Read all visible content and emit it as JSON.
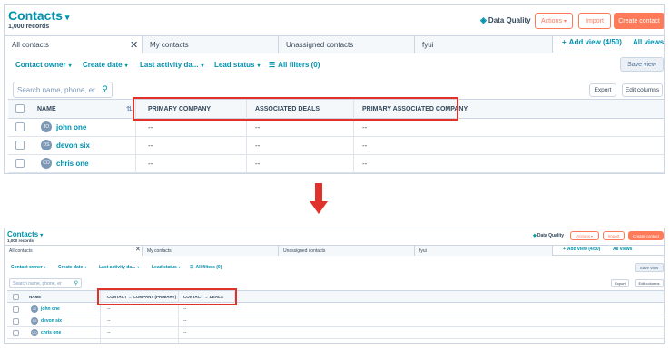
{
  "colors": {
    "accent": "#0091ae",
    "brand_orange": "#ff7a59",
    "highlight_red": "#e0312b",
    "text": "#33475b"
  },
  "header": {
    "title": "Contacts",
    "records": "1,000 records",
    "data_quality": "Data Quality",
    "actions": "Actions",
    "import": "Import",
    "create": "Create contact"
  },
  "tabs": {
    "all": "All contacts",
    "mine": "My contacts",
    "unassigned": "Unassigned contacts",
    "custom": "fyui",
    "add_view": "Add view (4/50)",
    "all_views": "All views"
  },
  "filters": {
    "owner": "Contact owner",
    "create_date": "Create date",
    "last_activity": "Last activity da...",
    "lead_status": "Lead status",
    "all_filters": "All filters (0)",
    "save_view": "Save view"
  },
  "table_tools": {
    "search_placeholder": "Search name, phone, er",
    "export": "Export",
    "edit_columns": "Edit columns"
  },
  "before": {
    "columns": {
      "name": "NAME",
      "c1": "PRIMARY COMPANY",
      "c2": "ASSOCIATED DEALS",
      "c3": "PRIMARY ASSOCIATED COMPANY"
    },
    "rows": [
      {
        "initials": "JO",
        "name": "john one",
        "c1": "--",
        "c2": "--",
        "c3": "--"
      },
      {
        "initials": "DS",
        "name": "devon six",
        "c1": "--",
        "c2": "--",
        "c3": "--"
      },
      {
        "initials": "CO",
        "name": "chris one",
        "c1": "--",
        "c2": "--",
        "c3": "--"
      }
    ]
  },
  "after": {
    "columns": {
      "name": "NAME",
      "c1": "CONTACT → COMPANY (PRIMARY)",
      "c2": "CONTACT → DEALS"
    },
    "rows": [
      {
        "initials": "JO",
        "name": "john one",
        "c1": "--",
        "c2": "--"
      },
      {
        "initials": "DS",
        "name": "devon six",
        "c1": "--",
        "c2": "--"
      },
      {
        "initials": "CO",
        "name": "chris one",
        "c1": "--",
        "c2": "--"
      }
    ]
  },
  "icons": {
    "caret": "▾",
    "close": "✕",
    "plus": "+",
    "search": "⚲",
    "data_quality": "◈",
    "filter": "☰",
    "sort": "⇅"
  }
}
